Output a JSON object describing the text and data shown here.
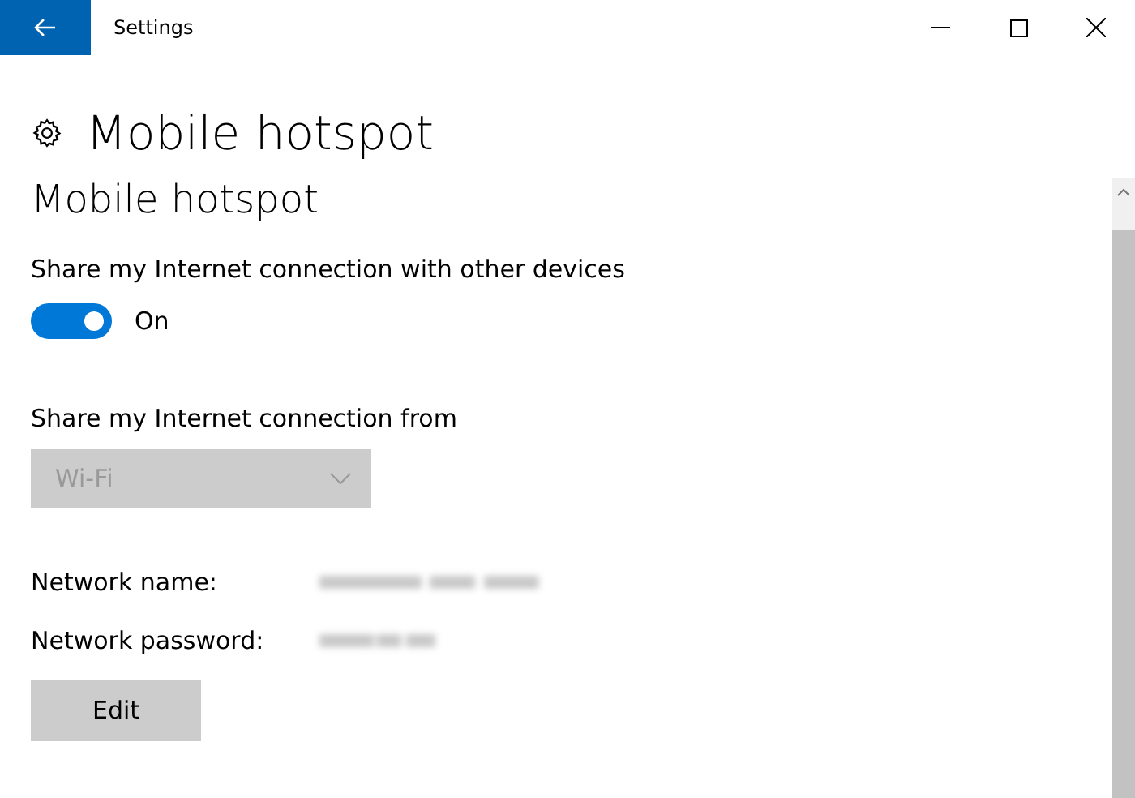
{
  "window": {
    "title": "Settings"
  },
  "page": {
    "title": "Mobile hotspot"
  },
  "section": {
    "title": "Mobile hotspot"
  },
  "share_toggle": {
    "label": "Share my Internet connection with other devices",
    "on": true,
    "state_label": "On"
  },
  "share_from": {
    "label": "Share my Internet connection from",
    "value": "Wi-Fi",
    "disabled": true
  },
  "network": [
    {
      "label": "Network name:"
    },
    {
      "label": "Network password:"
    }
  ],
  "buttons": [
    "Edit"
  ]
}
